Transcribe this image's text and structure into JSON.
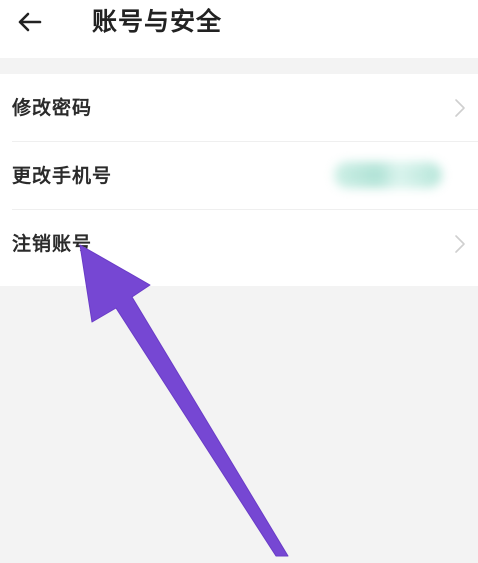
{
  "header": {
    "title": "账号与安全"
  },
  "menu": {
    "items": [
      {
        "label": "修改密码"
      },
      {
        "label": "更改手机号"
      },
      {
        "label": "注销账号"
      }
    ]
  },
  "colors": {
    "annotation_arrow": "#7647d3",
    "masked_value": "#a9e0d2"
  }
}
